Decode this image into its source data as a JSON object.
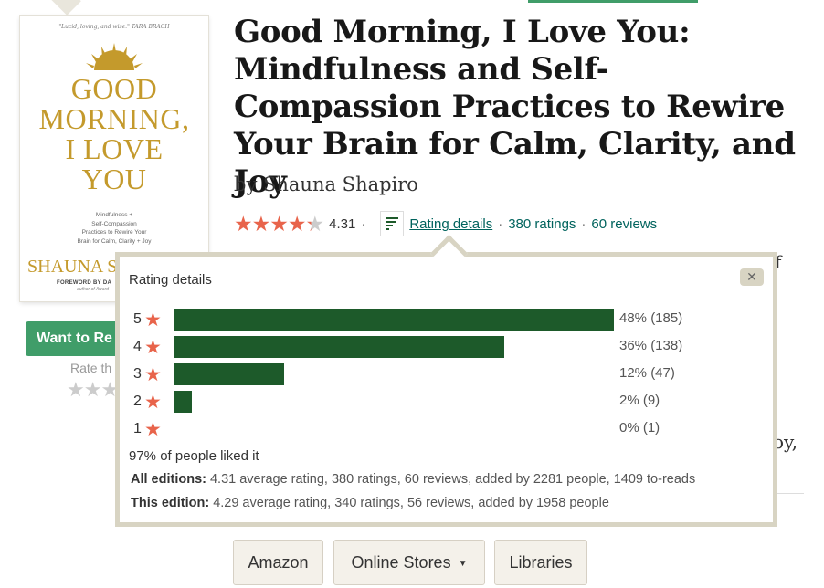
{
  "cover": {
    "quote": "\"Lucid, loving, and wise.\" TARA BRACH",
    "title_lines": [
      "GOOD",
      "MORNING,",
      "I LOVE",
      "YOU"
    ],
    "subtitle_lines": [
      "Mindfulness +",
      "Self-Compassion",
      "Practices to Rewire Your",
      "Brain for Calm, Clarity + Joy"
    ],
    "author": "SHAUNA S",
    "foreword": "FOREWORD BY DA",
    "foreword_sub": "author of Award"
  },
  "sidebar": {
    "want_to_read": "Want to Re",
    "rate_this": "Rate th",
    "empty_stars": "★★★"
  },
  "book": {
    "title": "Good Morning, I Love You: Mindfulness and Self-Compassion Practices to Rewire Your Brain for Calm, Clarity, and Joy",
    "byline_prefix": "by",
    "author": "Shauna Shapiro",
    "stars": "★★★★★",
    "average": "4.31",
    "rating_details_link": "Rating details",
    "ratings_link": "380 ratings",
    "reviews_link": "60 reviews",
    "sep": "·"
  },
  "background_fragments": {
    "f": "f",
    "oy": "oy,"
  },
  "popup": {
    "title": "Rating details",
    "close": "✕",
    "distribution": [
      {
        "stars": "5",
        "fraction": 0.48,
        "label": "48% (185)"
      },
      {
        "stars": "4",
        "fraction": 0.36,
        "label": "36% (138)"
      },
      {
        "stars": "3",
        "fraction": 0.12,
        "label": "12% (47)"
      },
      {
        "stars": "2",
        "fraction": 0.02,
        "label": "2% (9)"
      },
      {
        "stars": "1",
        "fraction": 0.0,
        "label": "0% (1)"
      }
    ],
    "star_glyph": "★",
    "liked": "97% of people liked it",
    "all_editions_label": "All editions:",
    "all_editions_text": "4.31 average rating, 380 ratings, 60 reviews, added by 2281 people, 1409 to-reads",
    "this_edition_label": "This edition:",
    "this_edition_text": "4.29 average rating, 340 ratings, 56 reviews, added by 1958 people"
  },
  "stores": {
    "amazon": "Amazon",
    "online_stores": "Online Stores",
    "libraries": "Libraries"
  },
  "colors": {
    "bar": "#1d5a2a",
    "star": "#e8644b",
    "link": "#00635d",
    "button_green": "#409d69",
    "popup_border": "#d8d4c3"
  }
}
